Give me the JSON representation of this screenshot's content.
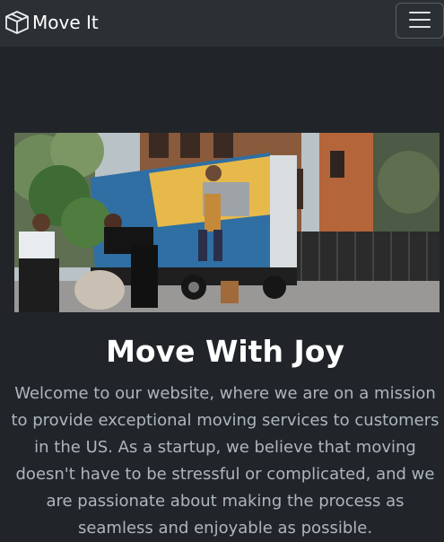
{
  "navbar": {
    "brand_label": "Move It",
    "brand_icon": "box-icon",
    "toggler_icon": "hamburger-menu-icon"
  },
  "hero": {
    "image_subject": "movers loading a moving truck in front of brownstone buildings",
    "title": "Move With Joy",
    "description": "Welcome to our website, where we are on a mission to provide exceptional moving services to customers in the US. As a startup, we believe that moving doesn't have to be stressful or complicated, and we are passionate about making the process as seamless and enjoyable as possible."
  }
}
